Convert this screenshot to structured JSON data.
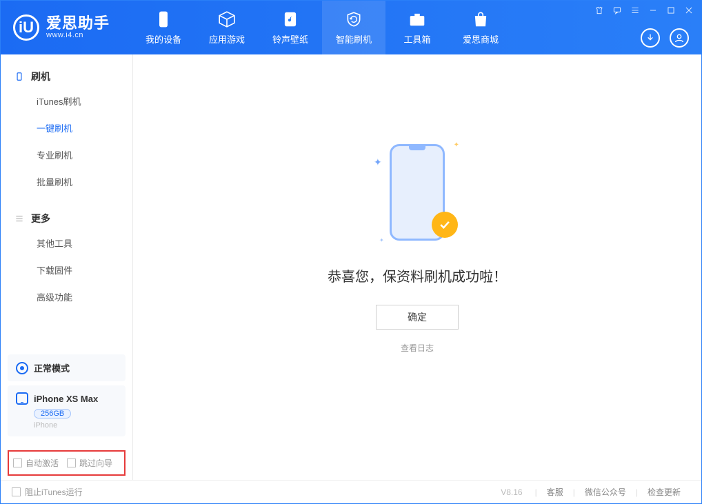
{
  "app": {
    "name": "爱思助手",
    "domain": "www.i4.cn",
    "logo_letter": "iU"
  },
  "tabs": {
    "device": "我的设备",
    "apps": "应用游戏",
    "ringtone": "铃声壁纸",
    "flash": "智能刷机",
    "toolbox": "工具箱",
    "store": "爱思商城"
  },
  "sidebar": {
    "group1": "刷机",
    "items1": [
      "iTunes刷机",
      "一键刷机",
      "专业刷机",
      "批量刷机"
    ],
    "group2": "更多",
    "items2": [
      "其他工具",
      "下载固件",
      "高级功能"
    ],
    "status": "正常模式",
    "device": {
      "name": "iPhone XS Max",
      "capacity": "256GB",
      "type": "iPhone"
    },
    "check_auto_activate": "自动激活",
    "check_skip_guide": "跳过向导"
  },
  "main": {
    "success": "恭喜您，保资料刷机成功啦！",
    "ok": "确定",
    "viewlog": "查看日志"
  },
  "footer": {
    "block_itunes": "阻止iTunes运行",
    "version": "V8.16",
    "support": "客服",
    "wechat": "微信公众号",
    "update": "检查更新"
  }
}
